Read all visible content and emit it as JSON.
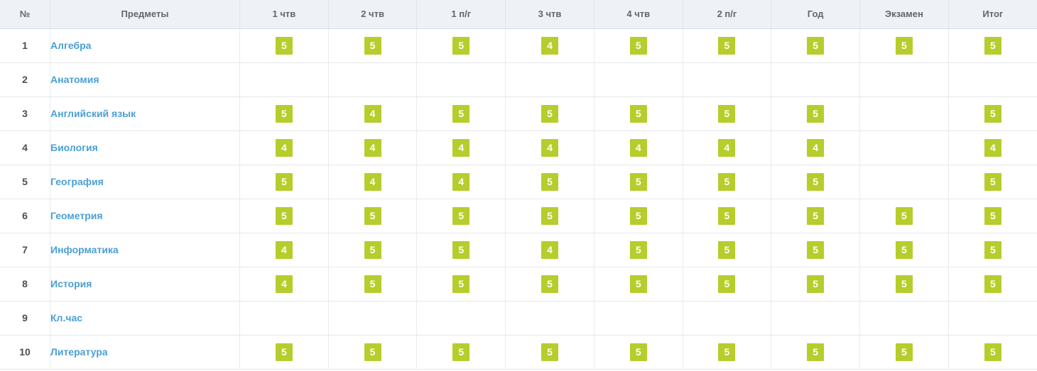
{
  "table": {
    "columns": [
      {
        "key": "num",
        "label": "№"
      },
      {
        "key": "subject",
        "label": "Предметы"
      },
      {
        "key": "q1",
        "label": "1 чтв"
      },
      {
        "key": "q2",
        "label": "2 чтв"
      },
      {
        "key": "h1",
        "label": "1 п/г"
      },
      {
        "key": "q3",
        "label": "3 чтв"
      },
      {
        "key": "q4",
        "label": "4 чтв"
      },
      {
        "key": "h2",
        "label": "2 п/г"
      },
      {
        "key": "year",
        "label": "Год"
      },
      {
        "key": "exam",
        "label": "Экзамен"
      },
      {
        "key": "total",
        "label": "Итог"
      }
    ],
    "rows": [
      {
        "num": "1",
        "subject": "Алгебра",
        "grades": [
          "5",
          "5",
          "5",
          "4",
          "5",
          "5",
          "5",
          "5",
          "5"
        ]
      },
      {
        "num": "2",
        "subject": "Анатомия",
        "grades": [
          "",
          "",
          "",
          "",
          "",
          "",
          "",
          "",
          ""
        ]
      },
      {
        "num": "3",
        "subject": "Английский язык",
        "grades": [
          "5",
          "4",
          "5",
          "5",
          "5",
          "5",
          "5",
          "",
          "5"
        ]
      },
      {
        "num": "4",
        "subject": "Биология",
        "grades": [
          "4",
          "4",
          "4",
          "4",
          "4",
          "4",
          "4",
          "",
          "4"
        ]
      },
      {
        "num": "5",
        "subject": "География",
        "grades": [
          "5",
          "4",
          "4",
          "5",
          "5",
          "5",
          "5",
          "",
          "5"
        ]
      },
      {
        "num": "6",
        "subject": "Геометрия",
        "grades": [
          "5",
          "5",
          "5",
          "5",
          "5",
          "5",
          "5",
          "5",
          "5"
        ]
      },
      {
        "num": "7",
        "subject": "Информатика",
        "grades": [
          "4",
          "5",
          "5",
          "4",
          "5",
          "5",
          "5",
          "5",
          "5"
        ]
      },
      {
        "num": "8",
        "subject": "История",
        "grades": [
          "4",
          "5",
          "5",
          "5",
          "5",
          "5",
          "5",
          "5",
          "5"
        ]
      },
      {
        "num": "9",
        "subject": "Кл.час",
        "grades": [
          "",
          "",
          "",
          "",
          "",
          "",
          "",
          "",
          ""
        ]
      },
      {
        "num": "10",
        "subject": "Литература",
        "grades": [
          "5",
          "5",
          "5",
          "5",
          "5",
          "5",
          "5",
          "5",
          "5"
        ]
      }
    ]
  },
  "colors": {
    "grade_badge_background": "#b6cd2c",
    "grade_badge_text": "#ffffff",
    "subject_link": "#4a9fd4",
    "header_background": "#eef2f7",
    "header_text": "#63676b",
    "row_border": "#e4e8ec"
  }
}
